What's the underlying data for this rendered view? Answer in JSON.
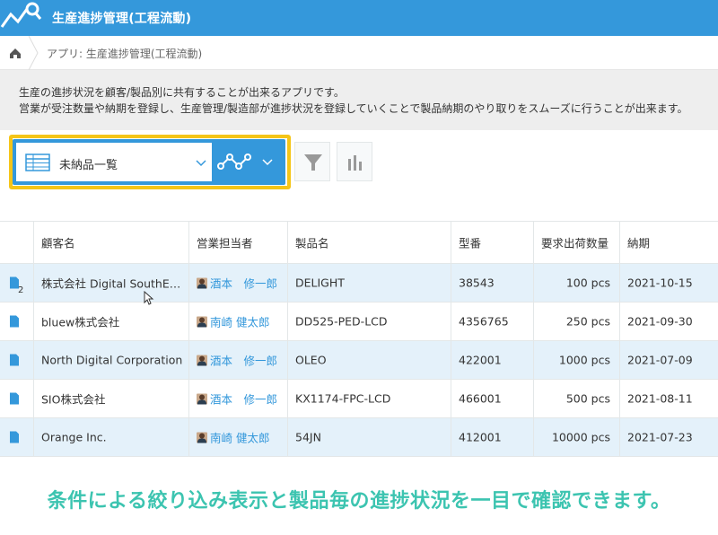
{
  "app": {
    "title": "生産進捗管理(工程流動)"
  },
  "breadcrumb": {
    "crumb": "アプリ: 生産進捗管理(工程流動)"
  },
  "description": {
    "line1": "生産の進捗状況を顧客/製品別に共有することが出来るアプリです。",
    "line2": "営業が受注数量や納期を登録し、生産管理/製造部が進捗状況を登録していくことで製品納期のやり取りをスムーズに行うことが出来ます。"
  },
  "view": {
    "selected": "未納品一覧"
  },
  "colors": {
    "accent": "#3498db",
    "highlight": "#f5c518",
    "row_alt": "#e4f1fa",
    "caption": "#3cc4b0"
  },
  "table": {
    "headers": [
      "顧客名",
      "営業担当者",
      "製品名",
      "型番",
      "要求出荷数量",
      "納期"
    ],
    "rows": [
      {
        "badge": "2",
        "customer": "株式会社 Digital SouthE…",
        "rep": "酒本　修一郎",
        "product": "DELIGHT",
        "model": "38543",
        "qty": "100 pcs",
        "due": "2021-10-15"
      },
      {
        "badge": "",
        "customer": "bluew株式会社",
        "rep": "南崎 健太郎",
        "product": "DD525-PED-LCD",
        "model": "4356765",
        "qty": "250 pcs",
        "due": "2021-09-30"
      },
      {
        "badge": "",
        "customer": "North Digital Corporation",
        "rep": "酒本　修一郎",
        "product": "OLEO",
        "model": "422001",
        "qty": "1000 pcs",
        "due": "2021-07-09"
      },
      {
        "badge": "",
        "customer": "SIO株式会社",
        "rep": "酒本　修一郎",
        "product": "KX1174-FPC-LCD",
        "model": "466001",
        "qty": "500 pcs",
        "due": "2021-08-11"
      },
      {
        "badge": "",
        "customer": "Orange Inc.",
        "rep": "南崎 健太郎",
        "product": "54JN",
        "model": "412001",
        "qty": "10000 pcs",
        "due": "2021-07-23"
      }
    ]
  },
  "caption": "条件による絞り込み表示と製品毎の進捗状況を一目で確認できます。"
}
